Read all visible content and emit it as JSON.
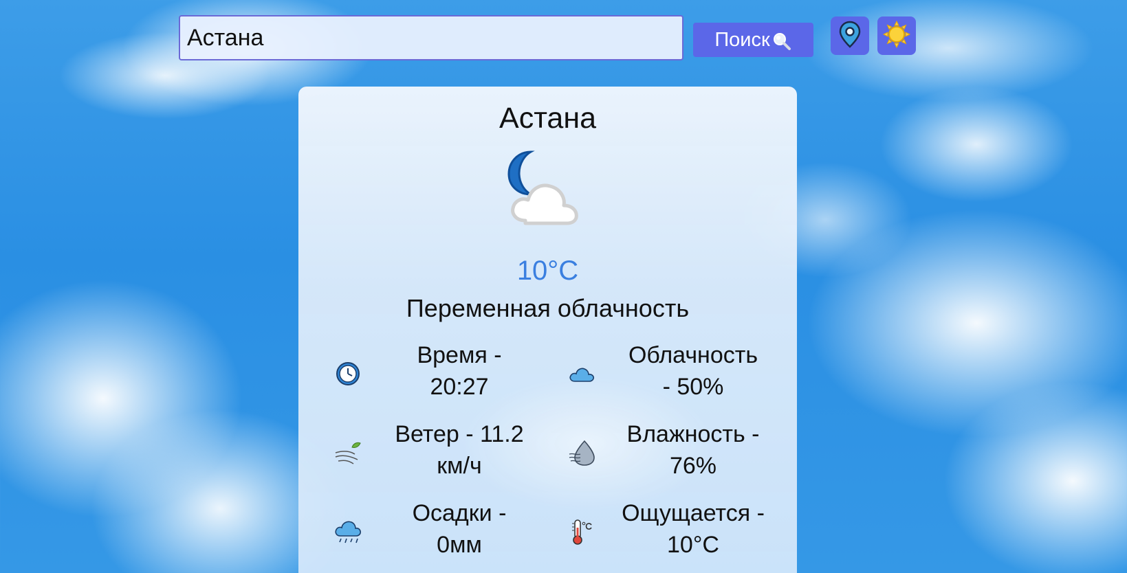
{
  "search": {
    "value": "Астана",
    "button_label": "Поиск"
  },
  "toolbar": {
    "location_icon": "location-pin-icon",
    "theme_icon": "sun-icon"
  },
  "weather": {
    "city": "Астана",
    "icon": "moon-cloud-icon",
    "temperature": "10°C",
    "description": "Переменная облачность",
    "details": {
      "time": {
        "line1": "Время -",
        "line2": "20:27",
        "icon": "clock-icon"
      },
      "clouds": {
        "line1": "Облачность",
        "line2": "- 50%",
        "icon": "cloud-icon"
      },
      "wind": {
        "line1": "Ветер - 11.2",
        "line2": "км/ч",
        "icon": "wind-icon"
      },
      "humidity": {
        "line1": "Влажность -",
        "line2": "76%",
        "icon": "humidity-drop-icon"
      },
      "precipitation": {
        "line1": "Осадки -",
        "line2": "0мм",
        "icon": "rain-cloud-icon"
      },
      "feels_like": {
        "line1": "Ощущается -",
        "line2": "10°C",
        "icon": "thermometer-icon"
      }
    }
  },
  "colors": {
    "accent": "#5b67e8",
    "temperature": "#3a7fe0",
    "sky": "#2a8fe3"
  }
}
